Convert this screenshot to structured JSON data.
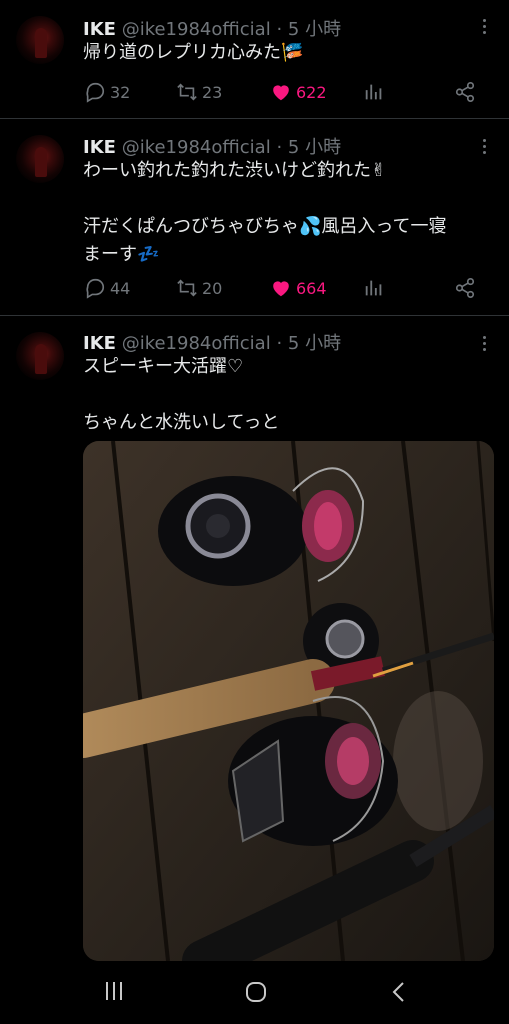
{
  "tweets": [
    {
      "name": "IKE",
      "handle": "@ike1984official",
      "sep": "·",
      "time": "5 小時",
      "text": "帰り道のレプリカ心みた🎏",
      "replies": "32",
      "retweets": "23",
      "likes": "622"
    },
    {
      "name": "IKE",
      "handle": "@ike1984official",
      "sep": "·",
      "time": "5 小時",
      "text": "わーい釣れた釣れた渋いけど釣れた✌\n\n汗だくぱんつびちゃびちゃ💦風呂入って一寝\nまーす💤",
      "replies": "44",
      "retweets": "20",
      "likes": "664"
    },
    {
      "name": "IKE",
      "handle": "@ike1984official",
      "sep": "·",
      "time": "5 小時",
      "text": "スピーキー大活躍♡\n\nちゃんと水洗いしてっと"
    }
  ],
  "icons": {
    "reply": "reply-icon",
    "retweet": "retweet-icon",
    "like": "heart-icon",
    "views": "views-icon",
    "share": "share-icon",
    "more": "more-icon"
  },
  "colors": {
    "background": "#000000",
    "like_active": "#f91880",
    "muted": "#71767b",
    "text": "#e7e9ea",
    "divider": "#2f3336"
  }
}
